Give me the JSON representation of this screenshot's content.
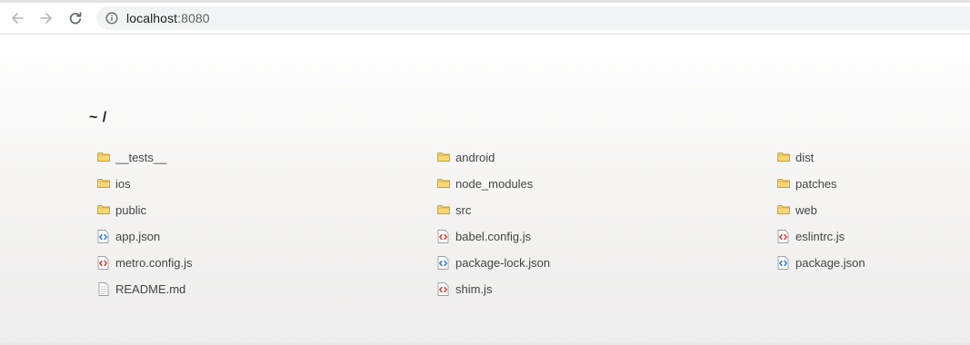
{
  "browser": {
    "url_host": "localhost",
    "url_port": ":8080"
  },
  "directory": {
    "title": "~ /",
    "columns": [
      [
        {
          "name": "__tests__",
          "type": "folder"
        },
        {
          "name": "ios",
          "type": "folder"
        },
        {
          "name": "public",
          "type": "folder"
        },
        {
          "name": "app.json",
          "type": "json"
        },
        {
          "name": "metro.config.js",
          "type": "js"
        },
        {
          "name": "README.md",
          "type": "text"
        }
      ],
      [
        {
          "name": "android",
          "type": "folder"
        },
        {
          "name": "node_modules",
          "type": "folder"
        },
        {
          "name": "src",
          "type": "folder"
        },
        {
          "name": "babel.config.js",
          "type": "js"
        },
        {
          "name": "package-lock.json",
          "type": "json"
        },
        {
          "name": "shim.js",
          "type": "js"
        }
      ],
      [
        {
          "name": "dist",
          "type": "folder"
        },
        {
          "name": "patches",
          "type": "folder"
        },
        {
          "name": "web",
          "type": "folder"
        },
        {
          "name": "eslintrc.js",
          "type": "js"
        },
        {
          "name": "package.json",
          "type": "json"
        }
      ]
    ]
  },
  "icons": {
    "folder": "folder-icon",
    "js": "js-file-icon",
    "json": "json-file-icon",
    "text": "text-file-icon"
  },
  "colors": {
    "folder_fill": "#f7d774",
    "folder_stroke": "#c9a12c",
    "js_accent": "#d93025",
    "json_accent": "#1a73e8"
  }
}
